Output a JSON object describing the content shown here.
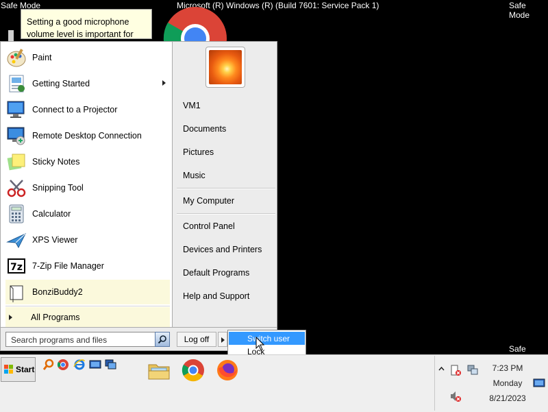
{
  "desktop": {
    "safe_mode_tl": "Safe Mode",
    "safe_mode_tr": "Safe Mode",
    "safe_mode_br": "Safe Mode",
    "title": "Microsoft (R) Windows (R) (Build 7601: Service Pack 1)",
    "tooltip_line1": "Setting a good microphone",
    "tooltip_line2": "volume level is important for"
  },
  "start_menu": {
    "programs": [
      {
        "label": "Paint",
        "icon": "paint-icon"
      },
      {
        "label": "Getting Started",
        "icon": "getting-started-icon",
        "submenu": true
      },
      {
        "label": "Connect to a Projector",
        "icon": "projector-icon"
      },
      {
        "label": "Remote Desktop Connection",
        "icon": "remote-desktop-icon"
      },
      {
        "label": "Sticky Notes",
        "icon": "sticky-notes-icon"
      },
      {
        "label": "Snipping Tool",
        "icon": "snipping-tool-icon"
      },
      {
        "label": "Calculator",
        "icon": "calculator-icon"
      },
      {
        "label": "XPS Viewer",
        "icon": "xps-viewer-icon"
      },
      {
        "label": "7-Zip File Manager",
        "icon": "7zip-icon"
      },
      {
        "label": "BonziBuddy2",
        "icon": "bonzibuddy-icon",
        "highlighted": true
      }
    ],
    "all_programs": "All Programs",
    "search_placeholder": "Search programs and files",
    "right_links": {
      "user": "VM1",
      "documents": "Documents",
      "pictures": "Pictures",
      "music": "Music",
      "my_computer": "My Computer",
      "control_panel": "Control Panel",
      "devices_printers": "Devices and Printers",
      "default_programs": "Default Programs",
      "help_support": "Help and Support"
    },
    "logoff_label": "Log off",
    "power_menu": {
      "switch_user": "Switch user",
      "lock": "Lock"
    }
  },
  "taskbar": {
    "start_label": "Start",
    "pinned": [
      "file-explorer-icon",
      "chrome-icon",
      "firefox-icon"
    ],
    "clock_time": "7:23 PM",
    "clock_day": "Monday",
    "clock_date": "8/21/2023"
  },
  "colors": {
    "selection": "#3399ff",
    "highlight": "#fbf9dc",
    "desktop": "#000000"
  }
}
